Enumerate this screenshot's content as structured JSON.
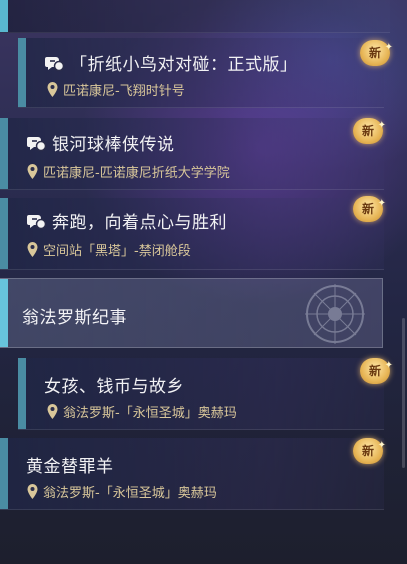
{
  "quests": [
    {
      "title": "「折纸小鸟对对碰：正式版」",
      "location": "匹诺康尼-飞翔时针号",
      "has_quest_icon": true,
      "badge": "新"
    },
    {
      "title": "银河球棒侠传说",
      "location": "匹诺康尼-匹诺康尼折纸大学学院",
      "has_quest_icon": true,
      "badge": "新"
    },
    {
      "title": "奔跑，向着点心与胜利",
      "location": "空间站「黑塔」-禁闭舱段",
      "has_quest_icon": true,
      "badge": "新"
    }
  ],
  "section": {
    "title": "翁法罗斯纪事"
  },
  "section_quests": [
    {
      "title": "女孩、钱币与故乡",
      "location": "翁法罗斯-「永恒圣城」奥赫玛",
      "badge": "新"
    },
    {
      "title": "黄金替罪羊",
      "location": "翁法罗斯-「永恒圣城」奥赫玛",
      "badge": "新"
    }
  ],
  "colors": {
    "accent_bar": "#4a8ca3",
    "location_text": "#d9c79a",
    "badge_gold": "#e7b657"
  },
  "icons": {
    "quest": "quest-chat-icon",
    "location": "location-pin-icon",
    "section_emblem": "emblem-icon"
  }
}
